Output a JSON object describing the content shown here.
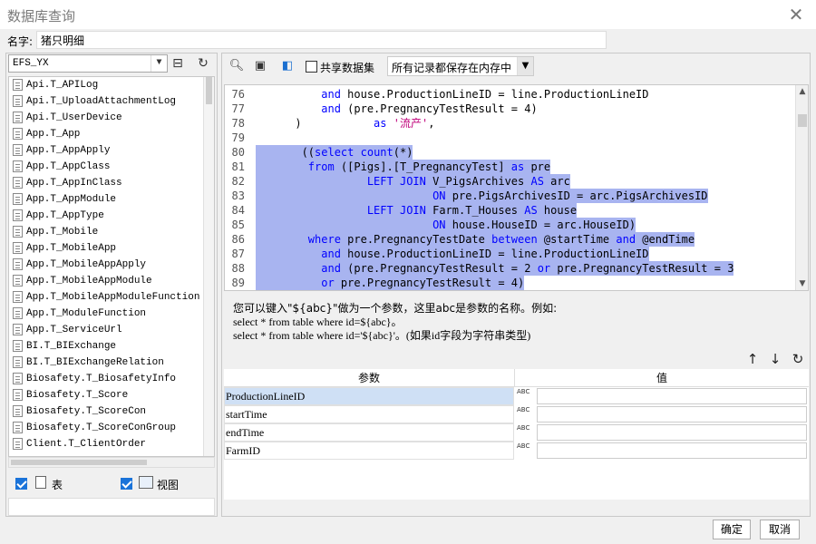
{
  "window": {
    "title": "数据库查询",
    "close_glyph": "✕"
  },
  "name_field": {
    "label": "名字:",
    "value": "猪只明细"
  },
  "left_panel": {
    "database": "EFS_YX",
    "tables": [
      "Api.T_APILog",
      "Api.T_UploadAttachmentLog",
      "Api.T_UserDevice",
      "App.T_App",
      "App.T_AppApply",
      "App.T_AppClass",
      "App.T_AppInClass",
      "App.T_AppModule",
      "App.T_AppType",
      "App.T_Mobile",
      "App.T_MobileApp",
      "App.T_MobileAppApply",
      "App.T_MobileAppModule",
      "App.T_MobileAppModuleFunction",
      "App.T_ModuleFunction",
      "App.T_ServiceUrl",
      "BI.T_BIExchange",
      "BI.T_BIExchangeRelation",
      "Biosafety.T_BiosafetyInfo",
      "Biosafety.T_Score",
      "Biosafety.T_ScoreCon",
      "Biosafety.T_ScoreConGroup",
      "Client.T_ClientOrder"
    ],
    "table_checkbox_label": "表",
    "view_checkbox_label": "视图",
    "table_checked": true,
    "view_checked": true
  },
  "toolbar": {
    "share_label": "共享数据集",
    "share_checked": false,
    "memory_mode": "所有记录都保存在内存中"
  },
  "editor": {
    "lines": [
      {
        "n": "76",
        "text": "          and house.ProductionLineID = line.ProductionLineID",
        "selected": false
      },
      {
        "n": "77",
        "text": "          and (pre.PregnancyTestResult = 4)",
        "selected": false
      },
      {
        "n": "78",
        "text": "      )           as '流产',",
        "selected": false
      },
      {
        "n": "79",
        "text": "",
        "selected": false
      },
      {
        "n": "80",
        "text": "       ((select count(*)",
        "selected": true
      },
      {
        "n": "81",
        "text": "        from ([Pigs].[T_PregnancyTest] as pre",
        "selected": true
      },
      {
        "n": "82",
        "text": "                 LEFT JOIN V_PigsArchives AS arc",
        "selected": true
      },
      {
        "n": "83",
        "text": "                           ON pre.PigsArchivesID = arc.PigsArchivesID",
        "selected": true
      },
      {
        "n": "84",
        "text": "                 LEFT JOIN Farm.T_Houses AS house",
        "selected": true
      },
      {
        "n": "85",
        "text": "                           ON house.HouseID = arc.HouseID)",
        "selected": true
      },
      {
        "n": "86",
        "text": "        where pre.PregnancyTestDate between @startTime and @endTime",
        "selected": true
      },
      {
        "n": "87",
        "text": "          and house.ProductionLineID = line.ProductionLineID",
        "selected": true
      },
      {
        "n": "88",
        "text": "          and (pre.PregnancyTestResult = 2 or pre.PregnancyTestResult = 3",
        "selected": true
      },
      {
        "n": "89",
        "text": "          or pre.PregnancyTestResult = 4)",
        "selected": true
      }
    ]
  },
  "help": {
    "line1": "您可以键入\"${abc}\"做为一个参数，这里abc是参数的名称。例如:",
    "line2": "select * from table where id=${abc}。",
    "line3": "select * from table where id='${abc}'。(如果id字段为字符串类型)"
  },
  "params": {
    "header_param": "参数",
    "header_value": "值",
    "type_badge": "ABC",
    "rows": [
      {
        "name": "ProductionLineID",
        "value": ""
      },
      {
        "name": "startTime",
        "value": ""
      },
      {
        "name": "endTime",
        "value": ""
      },
      {
        "name": "FarmID",
        "value": ""
      }
    ]
  },
  "footer": {
    "ok_label": "确定",
    "cancel_label": "取消"
  }
}
